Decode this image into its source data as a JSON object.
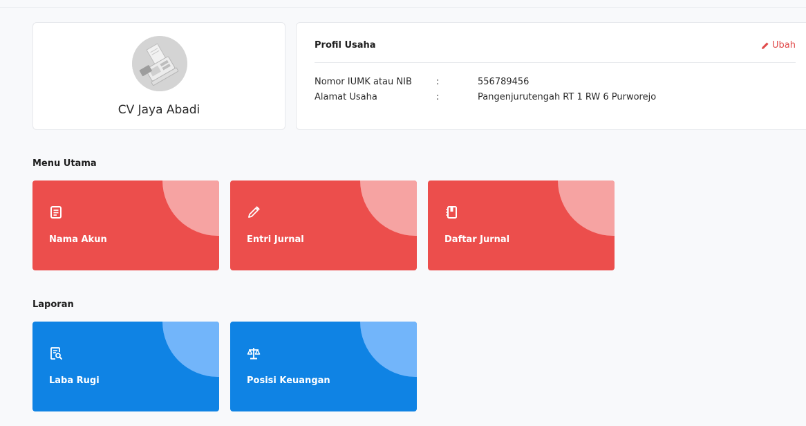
{
  "profile": {
    "business_name": "CV Jaya Abadi",
    "logo_icon": "cashier-machine-icon"
  },
  "info": {
    "title": "Profil Usaha",
    "edit_label": "Ubah",
    "rows": [
      {
        "label": "Nomor IUMK atau NIB",
        "sep": ":",
        "value": "556789456"
      },
      {
        "label": "Alamat Usaha",
        "sep": ":",
        "value": "Pangenjurutengah RT 1 RW 6 Purworejo"
      }
    ]
  },
  "menu_utama": {
    "title": "Menu Utama",
    "color": "#ec4e4c",
    "accent": "#f6a3a2",
    "items": [
      {
        "label": "Nama Akun",
        "icon": "document-list-icon"
      },
      {
        "label": "Entri Jurnal",
        "icon": "pencil-icon"
      },
      {
        "label": "Daftar Jurnal",
        "icon": "journal-book-icon"
      }
    ]
  },
  "laporan": {
    "title": "Laporan",
    "color": "#0f83e4",
    "accent": "#72b5fa",
    "items": [
      {
        "label": "Laba Rugi",
        "icon": "report-search-icon"
      },
      {
        "label": "Posisi Keuangan",
        "icon": "balance-scale-icon"
      }
    ]
  }
}
